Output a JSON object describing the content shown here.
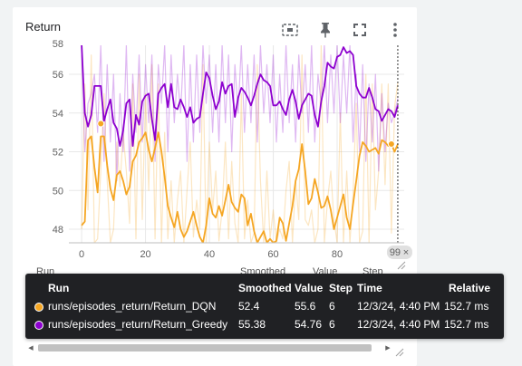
{
  "card": {
    "title": "Return"
  },
  "toolbar": {
    "icons": [
      "fit-domain-icon",
      "pin-icon",
      "fullscreen-icon",
      "more-vert-icon"
    ]
  },
  "chart_data": {
    "type": "line",
    "title": "Return",
    "xlim": [
      -4,
      101
    ],
    "ylim": [
      47.3,
      57.5
    ],
    "x_ticks": [
      0,
      20,
      40,
      60,
      80
    ],
    "y_ticks": [
      48,
      50,
      52,
      54,
      56
    ],
    "y_top_partial_tick": "58",
    "hover_step": 99,
    "hover_step_label": "99",
    "series": [
      {
        "name": "runs/episodes_return/Return_DQN",
        "color": "#f5a623",
        "smoothed": [
          48.2,
          48.4,
          52.6,
          52.8,
          51.2,
          49.9,
          52.8,
          52.8,
          51.3,
          50.1,
          49.5,
          50.8,
          51.0,
          50.5,
          49.8,
          50.2,
          51.5,
          51.8,
          52.5,
          52.7,
          53.0,
          52.1,
          51.5,
          52.2,
          53.0,
          52.0,
          50.7,
          49.2,
          48.6,
          48.1,
          48.9,
          48.0,
          47.6,
          47.9,
          48.4,
          48.9,
          48.2,
          47.6,
          47.3,
          48.2,
          49.6,
          48.8,
          48.6,
          49.2,
          48.7,
          49.5,
          50.3,
          49.4,
          49.1,
          48.9,
          49.8,
          49.6,
          48.2,
          48.8,
          47.9,
          47.3,
          47.6,
          47.9,
          47.3,
          47.5,
          47.3,
          47.4,
          48.6,
          48.3,
          47.4,
          48.3,
          49.2,
          50.5,
          51.1,
          52.4,
          51.0,
          49.3,
          49.6,
          50.6,
          49.9,
          49.1,
          49.2,
          49.7,
          49.0,
          48.0,
          48.6,
          49.2,
          49.8,
          48.6,
          48.0,
          49.3,
          50.5,
          51.8,
          52.5,
          52.3,
          52.0,
          52.1,
          52.2,
          51.9,
          52.6,
          52.5,
          52.3,
          52.4,
          52.0,
          52.4
        ],
        "value_line": [
          48.0,
          55.5,
          49.0,
          57.0,
          47.3,
          47.5,
          51.0,
          55.0,
          50.5,
          47.3,
          48.0,
          52.5,
          50.2,
          53.0,
          51.0,
          48.3,
          55.5,
          47.5,
          56.0,
          48.5,
          55.0,
          50.0,
          56.5,
          47.5,
          55.5,
          47.3,
          53.0,
          47.5,
          50.5,
          47.3,
          49.5,
          51.0,
          47.3,
          50.0,
          52.5,
          47.6,
          49.5,
          48.0,
          56.5,
          47.3,
          52.5,
          49.0,
          51.0,
          47.4,
          49.0,
          52.5,
          47.5,
          51.5,
          48.3,
          47.3,
          55.0,
          47.5,
          49.5,
          47.3,
          47.8,
          56.5,
          50.5,
          47.3,
          51.0,
          47.5,
          49.0,
          47.3,
          48.0,
          47.5,
          50.0,
          51.5,
          47.3,
          50.5,
          48.5,
          57.0,
          48.5,
          48.2,
          49.0,
          47.3,
          48.0,
          57.5,
          47.3,
          49.5,
          51.0,
          48.5,
          47.3,
          54.0,
          47.3,
          51.0,
          47.3,
          49.8,
          54.5,
          47.3,
          47.9,
          56.0,
          47.3,
          55.5,
          49.0,
          51.0,
          55.5,
          50.3,
          55.5,
          47.8,
          54.3,
          55.6
        ]
      },
      {
        "name": "runs/episodes_return/Return_Greedy",
        "color": "#8d00cf",
        "smoothed": [
          57.5,
          54.0,
          53.3,
          53.9,
          55.4,
          55.4,
          55.4,
          53.6,
          54.2,
          54.7,
          53.5,
          53.2,
          52.3,
          53.1,
          54.5,
          54.7,
          52.3,
          53.9,
          53.4,
          54.6,
          54.9,
          55.0,
          53.7,
          52.6,
          55.0,
          55.3,
          55.5,
          54.3,
          55.5,
          54.3,
          54.2,
          54.7,
          54.3,
          53.8,
          54.3,
          53.5,
          53.7,
          53.8,
          55.0,
          56.1,
          55.8,
          54.9,
          54.2,
          54.6,
          55.6,
          55.0,
          55.4,
          55.5,
          53.8,
          54.8,
          55.3,
          55.1,
          54.8,
          54.4,
          54.9,
          55.5,
          56.0,
          55.7,
          55.6,
          55.4,
          54.4,
          54.4,
          54.6,
          54.2,
          53.9,
          54.7,
          55.2,
          54.6,
          53.7,
          54.4,
          54.7,
          55.0,
          54.9,
          53.9,
          53.3,
          54.6,
          55.4,
          56.6,
          56.4,
          56.3,
          56.9,
          57.0,
          57.4,
          57.1,
          57.2,
          57.0,
          55.4,
          55.0,
          54.8,
          54.8,
          55.3,
          54.8,
          54.2,
          54.1,
          53.6,
          53.9,
          54.2,
          54.1,
          53.8,
          54.4
        ],
        "value_line": [
          57.0,
          52.0,
          54.5,
          55.0,
          56.0,
          53.0,
          57.5,
          51.5,
          56.5,
          52.5,
          56.0,
          50.5,
          55.0,
          52.0,
          57.5,
          51.0,
          56.0,
          53.0,
          57.0,
          52.5,
          56.5,
          53.5,
          57.0,
          51.5,
          56.5,
          54.5,
          57.5,
          52.0,
          57.0,
          53.5,
          56.0,
          54.0,
          57.5,
          51.5,
          56.5,
          52.5,
          57.0,
          53.0,
          57.5,
          54.5,
          57.0,
          53.0,
          56.5,
          52.5,
          57.5,
          53.5,
          57.0,
          52.0,
          56.5,
          54.0,
          57.5,
          53.0,
          56.5,
          53.5,
          57.0,
          52.5,
          57.5,
          54.0,
          56.5,
          53.5,
          57.0,
          52.5,
          56.0,
          53.0,
          57.5,
          53.5,
          56.5,
          52.5,
          57.0,
          54.0,
          56.5,
          53.0,
          57.5,
          52.5,
          56.0,
          54.5,
          57.5,
          53.5,
          57.0,
          54.0,
          57.5,
          53.5,
          57.0,
          54.0,
          57.5,
          52.5,
          56.0,
          52.0,
          56.5,
          51.5,
          55.5,
          52.5,
          56.0,
          51.0,
          55.0,
          52.0,
          54.5,
          53.5,
          54.0,
          54.76
        ]
      }
    ]
  },
  "table_ghost": {
    "headers": [
      "Run ↑",
      "Smoothed",
      "Value",
      "Step"
    ]
  },
  "tooltip": {
    "headers": {
      "run": "Run",
      "smoothed": "Smoothed",
      "value": "Value",
      "step": "Step",
      "time": "Time",
      "relative": "Relative"
    },
    "rows": [
      {
        "color": "#f5a623",
        "run": "runs/episodes_return/Return_DQN",
        "smoothed": "52.4",
        "value": "55.6",
        "step": "6",
        "time": "12/3/24, 4:40 PM",
        "relative": "152.7 ms"
      },
      {
        "color": "#8d00cf",
        "run": "runs/episodes_return/Return_Greedy",
        "smoothed": "55.38",
        "value": "54.76",
        "step": "6",
        "time": "12/3/24, 4:40 PM",
        "relative": "152.7 ms"
      }
    ]
  }
}
